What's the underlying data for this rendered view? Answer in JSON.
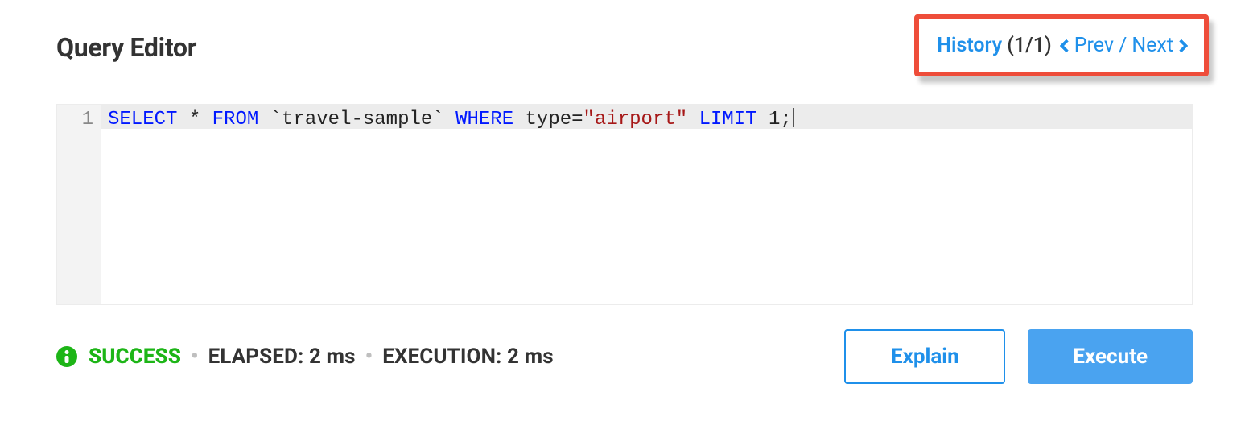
{
  "header": {
    "title": "Query Editor"
  },
  "history": {
    "label": "History",
    "count": "(1/1)",
    "prev": "Prev",
    "next": "Next"
  },
  "editor": {
    "line_number": "1",
    "tokens": {
      "select": "SELECT",
      "star": " * ",
      "from": "FROM",
      "bucket": " `travel-sample` ",
      "where": "WHERE",
      "typeeq": " type=",
      "strval": "\"airport\"",
      "space": " ",
      "limit": "LIMIT",
      "one": " 1",
      "semi": ";"
    }
  },
  "status": {
    "success": "SUCCESS",
    "elapsed": "ELAPSED: 2 ms",
    "execution": "EXECUTION: 2 ms"
  },
  "buttons": {
    "explain": "Explain",
    "execute": "Execute"
  }
}
